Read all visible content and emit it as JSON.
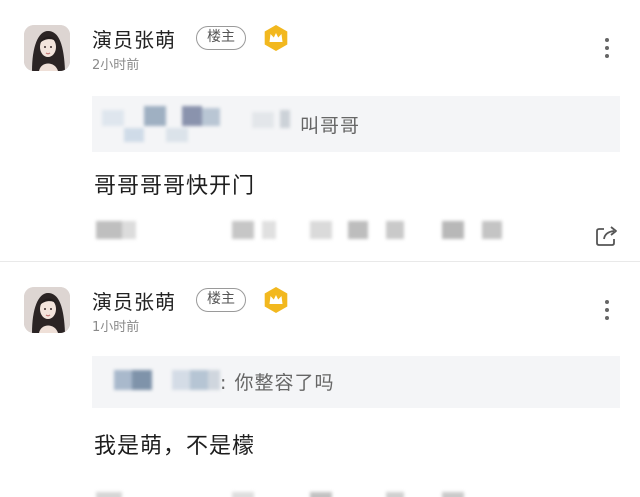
{
  "posts": [
    {
      "author": "演员张萌",
      "owner_badge": "楼主",
      "time": "2小时前",
      "quote": "叫哥哥",
      "comment": "哥哥哥哥快开门"
    },
    {
      "author": "演员张萌",
      "owner_badge": "楼主",
      "time": "1小时前",
      "quote": ": 你整容了吗",
      "comment": "我是萌，不是檬"
    }
  ],
  "icons": {
    "avatar": "avatar-photo",
    "crown": "crown-badge-icon",
    "more": "more-vertical-icon",
    "share": "share-icon"
  },
  "colors": {
    "crown_badge": "#f2b81f",
    "quote_background": "#f4f5f7",
    "divider": "#e9e9e9"
  }
}
